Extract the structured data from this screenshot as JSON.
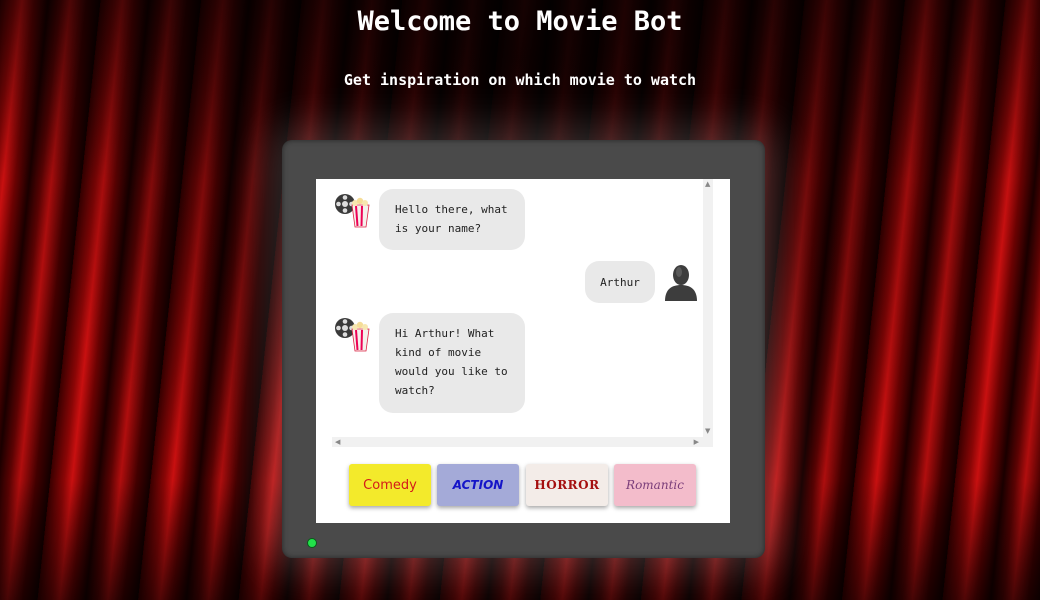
{
  "header": {
    "title": "Welcome to Movie Bot",
    "subtitle": "Get inspiration on which movie to watch"
  },
  "colors": {
    "tv_frame": "#4a4a4a",
    "screen": "#ffffff",
    "bubble": "#e9e9e9",
    "led": "#22e04a",
    "curtain": "#c81010"
  },
  "chat": {
    "messages": [
      {
        "sender": "bot",
        "text": "Hello there, what is your name?",
        "avatar_icon": "film-reel-popcorn-icon"
      },
      {
        "sender": "user",
        "text": "Arthur",
        "avatar_icon": "user-silhouette-icon"
      },
      {
        "sender": "bot",
        "text": "Hi Arthur! What kind of movie would you like to watch?",
        "avatar_icon": "film-reel-popcorn-icon"
      }
    ]
  },
  "genres": {
    "comedy": "Comedy",
    "action": "ACTION",
    "horror": "HORROR",
    "romantic": "Romantic"
  }
}
